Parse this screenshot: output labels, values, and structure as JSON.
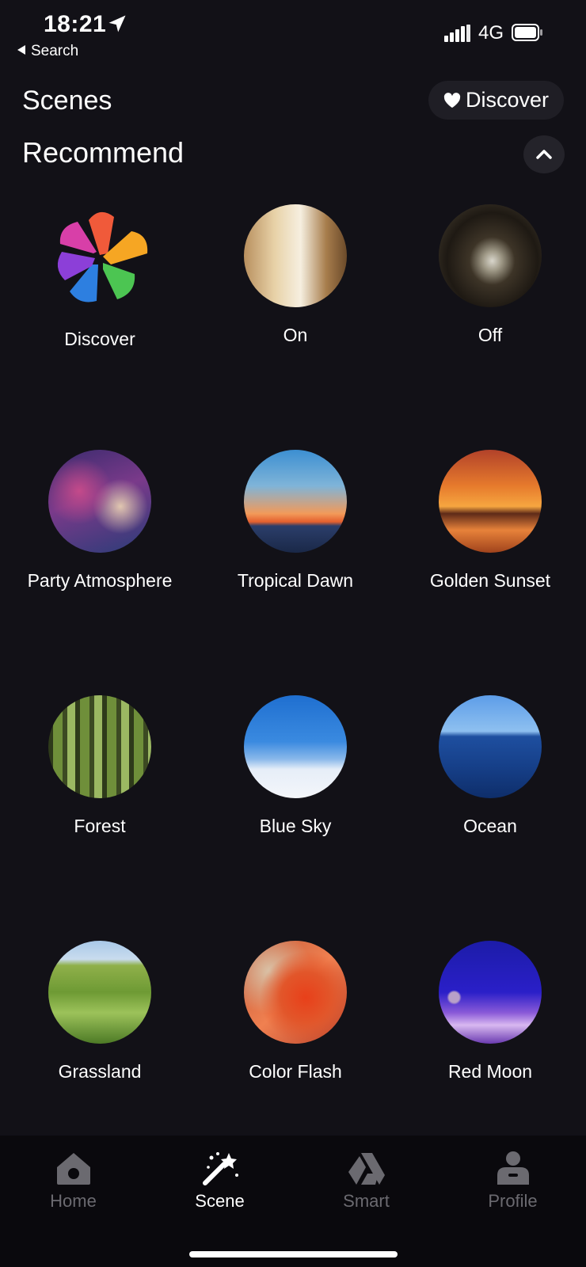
{
  "status": {
    "time": "18:21",
    "back_label": "Search",
    "network": "4G"
  },
  "header": {
    "title": "Scenes",
    "discover_button": "Discover"
  },
  "section": {
    "title": "Recommend"
  },
  "scenes": [
    {
      "label": "Discover"
    },
    {
      "label": "On"
    },
    {
      "label": "Off"
    },
    {
      "label": "Party Atmosphere"
    },
    {
      "label": "Tropical Dawn"
    },
    {
      "label": "Golden Sunset"
    },
    {
      "label": "Forest"
    },
    {
      "label": "Blue Sky"
    },
    {
      "label": "Ocean"
    },
    {
      "label": "Grassland"
    },
    {
      "label": "Color Flash"
    },
    {
      "label": "Red Moon"
    }
  ],
  "tabs": [
    {
      "label": "Home",
      "icon": "home-icon",
      "active": false
    },
    {
      "label": "Scene",
      "icon": "magic-wand-icon",
      "active": true
    },
    {
      "label": "Smart",
      "icon": "smart-icon",
      "active": false
    },
    {
      "label": "Profile",
      "icon": "profile-icon",
      "active": false
    }
  ],
  "colors": {
    "background": "#121117",
    "tab_inactive": "#6b6a70",
    "tab_active": "#ffffff"
  }
}
